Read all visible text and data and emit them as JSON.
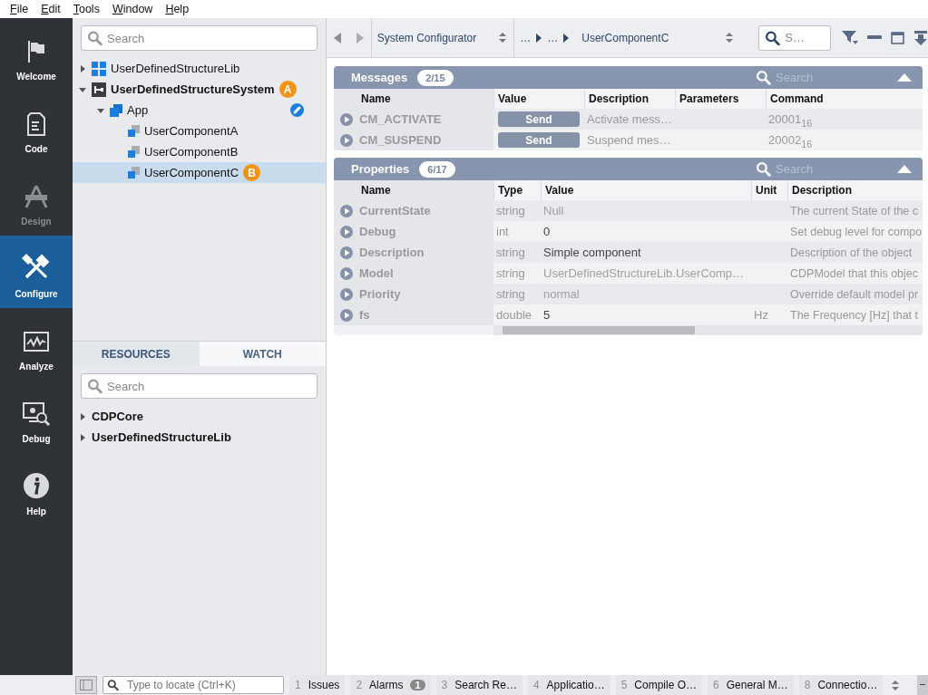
{
  "menu": [
    {
      "label": "File"
    },
    {
      "label": "Edit"
    },
    {
      "label": "Tools"
    },
    {
      "label": "Window"
    },
    {
      "label": "Help"
    }
  ],
  "nav": [
    {
      "kind": "welcome",
      "label": "Welcome",
      "selected": false,
      "disabled": false
    },
    {
      "kind": "code",
      "label": "Code",
      "selected": false,
      "disabled": false
    },
    {
      "kind": "design",
      "label": "Design",
      "selected": false,
      "disabled": true
    },
    {
      "kind": "configure",
      "label": "Configure",
      "selected": true,
      "disabled": false
    },
    {
      "kind": "analyze",
      "label": "Analyze",
      "selected": false,
      "disabled": false
    },
    {
      "kind": "debug",
      "label": "Debug",
      "selected": false,
      "disabled": false
    },
    {
      "kind": "help",
      "label": "Help",
      "selected": false,
      "disabled": false
    }
  ],
  "project_tree": {
    "search_placeholder": "Search",
    "items": [
      {
        "kind": "library",
        "label": "UserDefinedStructureLib",
        "expanded": false,
        "selected": false,
        "bold": false
      },
      {
        "kind": "system",
        "label": "UserDefinedStructureSystem",
        "expanded": true,
        "selected": false,
        "bold": true,
        "badge": "A",
        "children": [
          {
            "kind": "app",
            "label": "App",
            "expanded": true,
            "selected": false,
            "bold": false,
            "linked": true,
            "children": [
              {
                "kind": "component",
                "label": "UserComponentA",
                "selected": false,
                "bold": false
              },
              {
                "kind": "component",
                "label": "UserComponentB",
                "selected": false,
                "bold": false
              },
              {
                "kind": "component",
                "label": "UserComponentC",
                "selected": true,
                "bold": false,
                "badge": "B"
              }
            ]
          }
        ]
      }
    ]
  },
  "lower_tabs": [
    {
      "label": "RESOURCES",
      "selected": true
    },
    {
      "label": "WATCH",
      "selected": false
    }
  ],
  "resources": {
    "search_placeholder": "Search",
    "items": [
      {
        "label": "CDPCore",
        "expanded": false
      },
      {
        "label": "UserDefinedStructureLib",
        "expanded": false
      }
    ]
  },
  "toolbar": {
    "view": "System Configurator",
    "breadcrumb": [
      "…",
      "…",
      "UserComponentC"
    ],
    "search_placeholder": "S…"
  },
  "messages": {
    "title": "Messages",
    "count": "2/15",
    "search_placeholder": "Search",
    "columns": [
      "Name",
      "Value",
      "Description",
      "Parameters",
      "Command"
    ],
    "rows": [
      {
        "name": "CM_ACTIVATE",
        "value": "Send",
        "description": "Activate mess…",
        "parameters": "",
        "command": "20001$_{16}$"
      },
      {
        "name": "CM_SUSPEND",
        "value": "Send",
        "description": "Suspend mes…",
        "parameters": "",
        "command": "20002$_{16}$"
      }
    ]
  },
  "properties": {
    "title": "Properties",
    "count": "6/17",
    "search_placeholder": "Search",
    "columns": [
      "Name",
      "Type",
      "Value",
      "Unit",
      "Description"
    ],
    "rows": [
      {
        "name": "CurrentState",
        "type": "string",
        "value": "Null",
        "default": true,
        "unit": "",
        "description": "The current State of the c"
      },
      {
        "name": "Debug",
        "type": "int",
        "value": "0",
        "default": false,
        "unit": "",
        "description": "Set debug level for compo"
      },
      {
        "name": "Description",
        "type": "string",
        "value": "Simple component",
        "default": false,
        "unit": "",
        "description": "Description of the object"
      },
      {
        "name": "Model",
        "type": "string",
        "value": "UserDefinedStructureLib.UserComp…",
        "default": true,
        "unit": "",
        "description": "CDPModel that this objec"
      },
      {
        "name": "Priority",
        "type": "string",
        "value": "normal",
        "default": true,
        "unit": "",
        "description": "Override default model pr"
      },
      {
        "name": "fs",
        "type": "double",
        "value": "5",
        "default": false,
        "unit": "Hz",
        "description": "The Frequency [Hz] that t"
      }
    ]
  },
  "status_bar": {
    "locate_placeholder": "Type to locate (Ctrl+K)",
    "tabs": [
      {
        "number": "1",
        "label": "Issues"
      },
      {
        "number": "2",
        "label": "Alarms",
        "badge": "1"
      },
      {
        "number": "3",
        "label": "Search Re…"
      },
      {
        "number": "4",
        "label": "Applicatio…"
      },
      {
        "number": "5",
        "label": "Compile O…"
      },
      {
        "number": "6",
        "label": "General M…"
      },
      {
        "number": "8",
        "label": "Connectio…"
      }
    ]
  }
}
